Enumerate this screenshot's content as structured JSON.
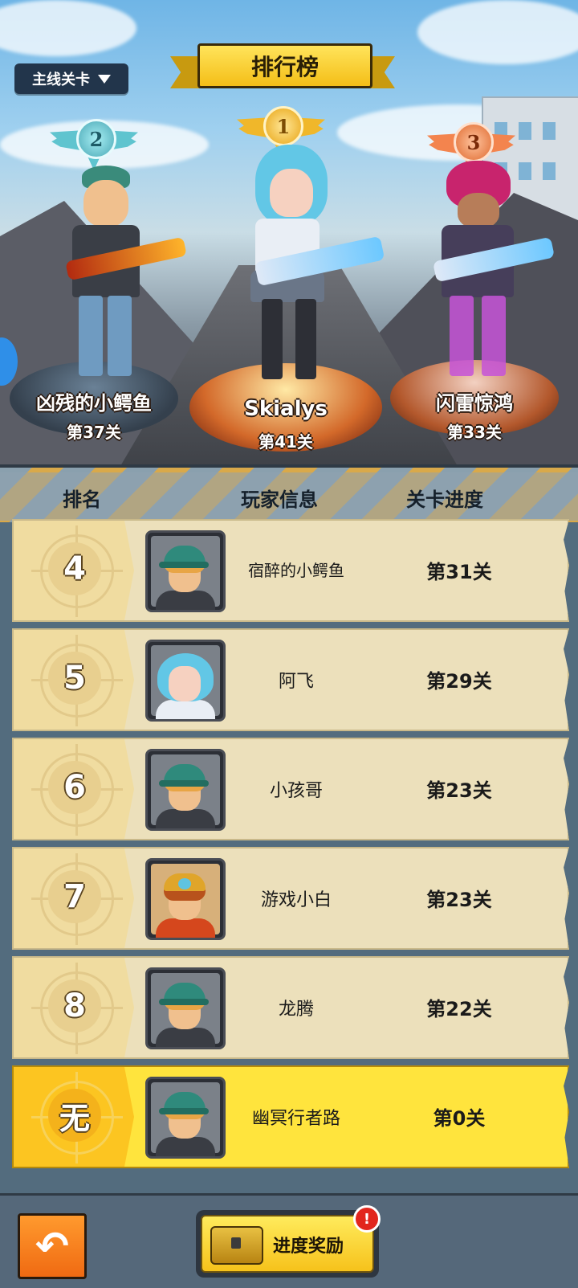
{
  "header": {
    "title": "排行榜",
    "mode_select": "主线关卡"
  },
  "podium": [
    {
      "rank": "2",
      "name": "凶残的小鳄鱼",
      "level": "第37关"
    },
    {
      "rank": "1",
      "name": "Skialys",
      "level": "第41关"
    },
    {
      "rank": "3",
      "name": "闪雷惊鸿",
      "level": "第33关"
    }
  ],
  "columns": {
    "rank": "排名",
    "player": "玩家信息",
    "progress": "关卡进度"
  },
  "rows": [
    {
      "rank": "4",
      "name": "宿醉的小鳄鱼",
      "level": "第31关",
      "avatar": "boy-cap"
    },
    {
      "rank": "5",
      "name": "阿飞",
      "level": "第29关",
      "avatar": "girl-blue-hair"
    },
    {
      "rank": "6",
      "name": "小孩哥",
      "level": "第23关",
      "avatar": "boy-cap"
    },
    {
      "rank": "7",
      "name": "游戏小白",
      "level": "第23关",
      "avatar": "warrior-helmet"
    },
    {
      "rank": "8",
      "name": "龙腾",
      "level": "第22关",
      "avatar": "boy-cap"
    }
  ],
  "me": {
    "rank": "无",
    "name": "幽冥行者路",
    "level": "第0关",
    "avatar": "boy-cap"
  },
  "bottom": {
    "back_icon": "back-arrow-icon",
    "reward_label": "进度奖励",
    "reward_badge": "!"
  },
  "colors": {
    "row_bg": "#ece0bb",
    "me_row_bg": "#ffe43d",
    "banner": "#f4be17"
  }
}
